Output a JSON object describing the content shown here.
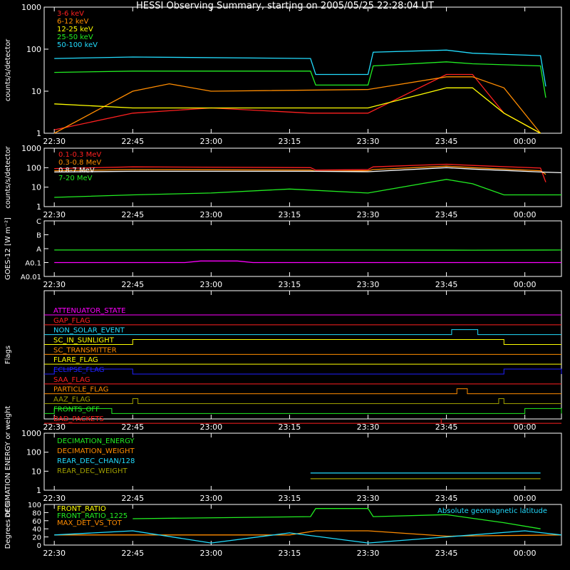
{
  "title": "HESSI Observing Summary, starting on 2005/05/25 22:28:04 UT",
  "time_ticks": [
    "22:30",
    "22:45",
    "23:00",
    "23:15",
    "23:30",
    "23:45",
    "00:00"
  ],
  "colors": {
    "red": "#ff2020",
    "orange": "#ff8c00",
    "yellow": "#ffff00",
    "green": "#22ee22",
    "cyan": "#22ddff",
    "magenta": "#ff00ff",
    "blue": "#2020ff",
    "white": "#ffffff",
    "olive": "#a0a000"
  },
  "chart_data": [
    {
      "id": "panel1",
      "type": "line",
      "ylabel": "counts/s/detector",
      "yscale": "log",
      "ylim": [
        1,
        1000
      ],
      "yticks": [
        "1",
        "10",
        "100",
        "1000"
      ],
      "xlim": [
        "22:28:04",
        "00:07:00"
      ],
      "series": [
        {
          "name": "3-6 keV",
          "color": "#ff2020",
          "points": [
            [
              "22:30",
              1.2
            ],
            [
              "22:45",
              3
            ],
            [
              "23:00",
              4
            ],
            [
              "23:19",
              3
            ],
            [
              "23:30",
              3
            ],
            [
              "23:45",
              25
            ],
            [
              "23:50",
              25
            ],
            [
              "23:56",
              3
            ],
            [
              "00:03",
              1
            ]
          ]
        },
        {
          "name": "6-12 keV",
          "color": "#ff8c00",
          "points": [
            [
              "22:30",
              1
            ],
            [
              "22:45",
              10
            ],
            [
              "22:52",
              15
            ],
            [
              "23:00",
              10
            ],
            [
              "23:30",
              11
            ],
            [
              "23:45",
              22
            ],
            [
              "23:50",
              22
            ],
            [
              "23:56",
              12
            ],
            [
              "00:03",
              1
            ]
          ]
        },
        {
          "name": "12-25 keV",
          "color": "#ffff00",
          "points": [
            [
              "22:30",
              5
            ],
            [
              "22:45",
              4
            ],
            [
              "23:30",
              4
            ],
            [
              "23:45",
              12
            ],
            [
              "23:50",
              12
            ],
            [
              "23:56",
              3
            ],
            [
              "00:03",
              1
            ]
          ]
        },
        {
          "name": "25-50 keV",
          "color": "#22ee22",
          "points": [
            [
              "22:30",
              28
            ],
            [
              "22:45",
              30
            ],
            [
              "23:19",
              30
            ],
            [
              "23:20",
              14
            ],
            [
              "23:30",
              14
            ],
            [
              "23:31",
              40
            ],
            [
              "23:45",
              50
            ],
            [
              "23:50",
              45
            ],
            [
              "00:03",
              40
            ],
            [
              "00:04",
              7
            ]
          ]
        },
        {
          "name": "50-100 keV",
          "color": "#22ddff",
          "points": [
            [
              "22:30",
              60
            ],
            [
              "22:45",
              65
            ],
            [
              "23:19",
              60
            ],
            [
              "23:20",
              25
            ],
            [
              "23:30",
              25
            ],
            [
              "23:31",
              85
            ],
            [
              "23:45",
              95
            ],
            [
              "23:50",
              80
            ],
            [
              "00:03",
              70
            ],
            [
              "00:04",
              13
            ]
          ]
        }
      ]
    },
    {
      "id": "panel2",
      "type": "line",
      "ylabel": "counts/s/detector",
      "yscale": "log",
      "ylim": [
        1,
        1000
      ],
      "yticks": [
        "1",
        "10",
        "100",
        "1000"
      ],
      "xlim": [
        "22:28:04",
        "00:07:00"
      ],
      "series": [
        {
          "name": "0.1-0.3 MeV",
          "color": "#ff2020",
          "points": [
            [
              "22:30",
              90
            ],
            [
              "22:45",
              110
            ],
            [
              "23:19",
              100
            ],
            [
              "23:20",
              75
            ],
            [
              "23:30",
              80
            ],
            [
              "23:31",
              110
            ],
            [
              "23:45",
              150
            ],
            [
              "23:50",
              130
            ],
            [
              "00:03",
              95
            ],
            [
              "00:04",
              18
            ]
          ]
        },
        {
          "name": "0.3-0.8 MeV",
          "color": "#ff8c00",
          "points": [
            [
              "22:30",
              70
            ],
            [
              "22:45",
              80
            ],
            [
              "23:19",
              75
            ],
            [
              "23:20",
              65
            ],
            [
              "23:30",
              70
            ],
            [
              "23:31",
              80
            ],
            [
              "23:45",
              120
            ],
            [
              "23:50",
              100
            ],
            [
              "00:03",
              70
            ],
            [
              "00:04",
              45
            ]
          ]
        },
        {
          "name": "0.8-7 MeV",
          "color": "#ffffff",
          "points": [
            [
              "22:30",
              60
            ],
            [
              "22:45",
              65
            ],
            [
              "23:19",
              65
            ],
            [
              "23:30",
              62
            ],
            [
              "23:45",
              100
            ],
            [
              "23:50",
              85
            ],
            [
              "00:03",
              60
            ],
            [
              "00:07",
              55
            ]
          ]
        },
        {
          "name": "7-20 MeV",
          "color": "#22ee22",
          "points": [
            [
              "22:30",
              3
            ],
            [
              "22:45",
              4
            ],
            [
              "23:00",
              5
            ],
            [
              "23:15",
              8
            ],
            [
              "23:30",
              5
            ],
            [
              "23:45",
              25
            ],
            [
              "23:50",
              15
            ],
            [
              "23:56",
              4
            ],
            [
              "00:07",
              4
            ]
          ]
        }
      ]
    },
    {
      "id": "panel3",
      "type": "line",
      "ylabel": "GOES-12 [W m⁻²]",
      "yscale": "log",
      "yticks": [
        "A0.01",
        "A0.1",
        "A",
        "B",
        "C"
      ],
      "series": [
        {
          "name": "GOES long",
          "color": "#22ee22",
          "points": [
            [
              "22:30",
              0.8
            ],
            [
              "23:00",
              0.82
            ],
            [
              "23:30",
              0.8
            ],
            [
              "23:50",
              0.78
            ],
            [
              "00:07",
              0.8
            ]
          ]
        },
        {
          "name": "GOES short",
          "color": "#ff00ff",
          "points": [
            [
              "22:30",
              0.1
            ],
            [
              "22:55",
              0.1
            ],
            [
              "22:58",
              0.13
            ],
            [
              "23:05",
              0.13
            ],
            [
              "23:08",
              0.1
            ],
            [
              "00:07",
              0.1
            ]
          ]
        }
      ]
    },
    {
      "id": "panel4",
      "type": "line",
      "ylabel": "Flags",
      "flags": [
        {
          "name": "ATTENUATOR_STATE",
          "color": "#ff00ff",
          "steps": []
        },
        {
          "name": "GAP_FLAG",
          "color": "#ff2020",
          "steps": []
        },
        {
          "name": "NON_SOLAR_EVENT",
          "color": "#22ddff",
          "steps": [
            [
              "23:46",
              "23:51"
            ]
          ]
        },
        {
          "name": "SC_IN_SUNLIGHT",
          "color": "#ffff00",
          "steps": [
            [
              "22:45",
              "23:56"
            ]
          ]
        },
        {
          "name": "SC_TRANSMITTER",
          "color": "#ff8c00",
          "steps": []
        },
        {
          "name": "FLARE_FLAG",
          "color": "#ffff00",
          "steps": []
        },
        {
          "name": "ECLIPSE_FLAG",
          "color": "#2020ff",
          "steps": [
            [
              "22:30",
              "22:45"
            ],
            [
              "23:56",
              "00:07"
            ]
          ]
        },
        {
          "name": "SAA_FLAG",
          "color": "#ff2020",
          "steps": []
        },
        {
          "name": "PARTICLE_FLAG",
          "color": "#ff8c00",
          "steps": [
            [
              "23:47",
              "23:49"
            ]
          ]
        },
        {
          "name": "AAZ_FLAG",
          "color": "#a0a000",
          "steps": [
            [
              "22:45",
              "22:46"
            ],
            [
              "23:55",
              "23:56"
            ]
          ]
        },
        {
          "name": "FRONTS_OFF",
          "color": "#22ee22",
          "steps": [
            [
              "22:30",
              "22:41"
            ],
            [
              "00:00",
              "00:07"
            ]
          ]
        },
        {
          "name": "BAD_PACKETS",
          "color": "#ff2020",
          "steps": [
            [
              "23:44",
              "23:44"
            ]
          ]
        }
      ]
    },
    {
      "id": "panel5",
      "type": "line",
      "ylabel": "DECIMATION ENERGY or weight",
      "yscale": "log",
      "ylim": [
        1,
        1000
      ],
      "yticks": [
        "1",
        "10",
        "100",
        "1000"
      ],
      "series": [
        {
          "name": "DECIMATION_ENERGY",
          "color": "#22ee22",
          "points": []
        },
        {
          "name": "DECIMATION_WEIGHT",
          "color": "#ff8c00",
          "points": []
        },
        {
          "name": "REAR_DEC_CHAN/128",
          "color": "#22ddff",
          "points": [
            [
              "23:19",
              8
            ],
            [
              "23:30",
              8
            ],
            [
              "00:03",
              8
            ]
          ]
        },
        {
          "name": "REAR_DEC_WEIGHT",
          "color": "#a0a000",
          "points": [
            [
              "23:19",
              4
            ],
            [
              "23:30",
              4
            ],
            [
              "00:03",
              4
            ]
          ]
        }
      ]
    },
    {
      "id": "panel6",
      "type": "line",
      "ylabel": "Degrees or %",
      "ylim": [
        0,
        100
      ],
      "yticks": [
        "0",
        "20",
        "40",
        "60",
        "80",
        "100"
      ],
      "annotation": "Absolute geomagnetic latitude",
      "series": [
        {
          "name": "FRONT_RATIO",
          "color": "#ffff00",
          "points": []
        },
        {
          "name": "FRONT_RATIO_1225",
          "color": "#22ee22",
          "points": [
            [
              "22:45",
              65
            ],
            [
              "23:19",
              70
            ],
            [
              "23:20",
              90
            ],
            [
              "23:30",
              90
            ],
            [
              "23:31",
              70
            ],
            [
              "23:45",
              75
            ],
            [
              "23:56",
              55
            ],
            [
              "00:03",
              40
            ]
          ]
        },
        {
          "name": "MAX_DET_VS_TOT",
          "color": "#ff8c00",
          "points": [
            [
              "22:30",
              25
            ],
            [
              "23:15",
              25
            ],
            [
              "23:20",
              35
            ],
            [
              "23:30",
              35
            ],
            [
              "23:45",
              22
            ],
            [
              "00:07",
              25
            ]
          ]
        },
        {
          "name": "Absolute geomagnetic latitude",
          "color": "#22ddff",
          "points": [
            [
              "22:30",
              25
            ],
            [
              "22:45",
              35
            ],
            [
              "23:00",
              5
            ],
            [
              "23:15",
              30
            ],
            [
              "23:30",
              5
            ],
            [
              "23:45",
              20
            ],
            [
              "00:00",
              35
            ],
            [
              "00:07",
              25
            ]
          ]
        }
      ]
    }
  ]
}
